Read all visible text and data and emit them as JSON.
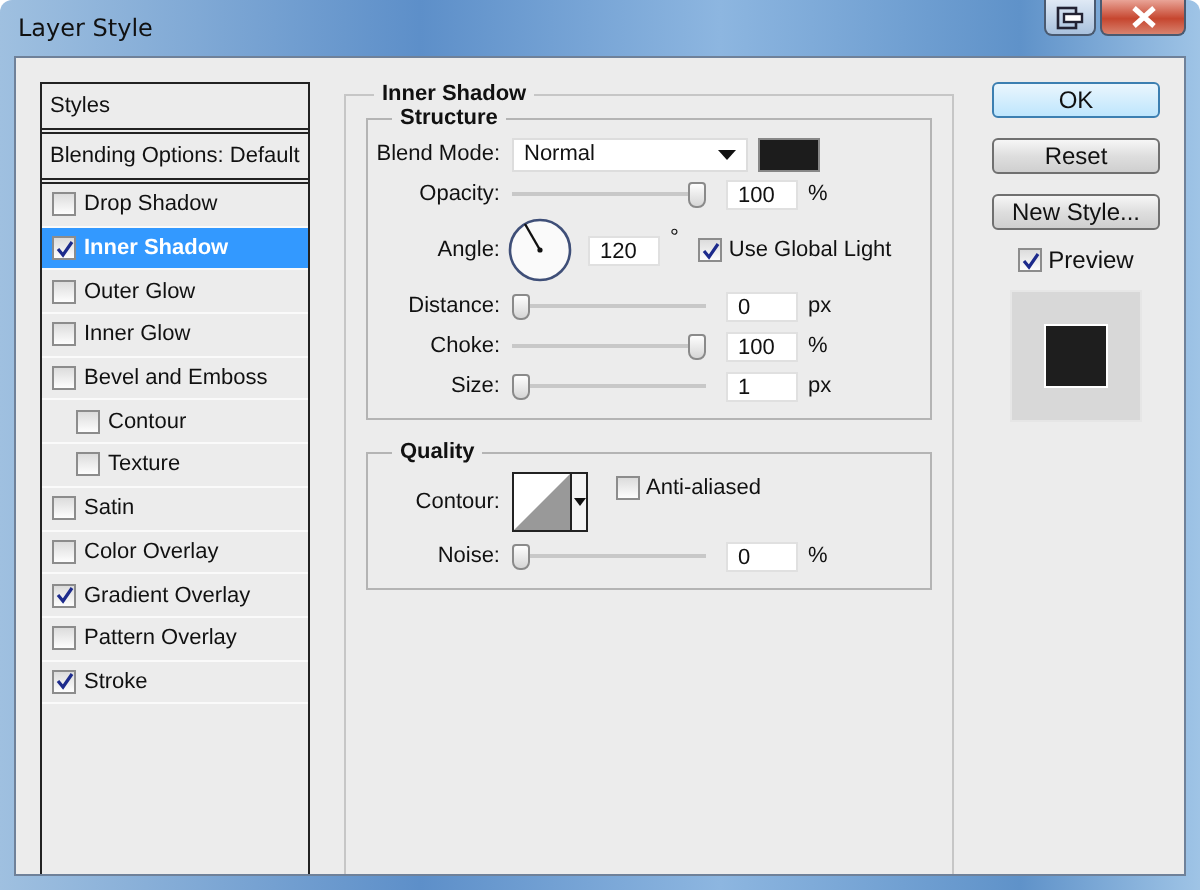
{
  "window": {
    "title": "Layer Style"
  },
  "styles_list": {
    "header": "Styles",
    "items": [
      {
        "kind": "plain",
        "label": "Blending Options: Default",
        "selected": false
      },
      {
        "kind": "check",
        "label": "Drop Shadow",
        "checked": false,
        "selected": false
      },
      {
        "kind": "check",
        "label": "Inner Shadow",
        "checked": true,
        "selected": true
      },
      {
        "kind": "check",
        "label": "Outer Glow",
        "checked": false,
        "selected": false
      },
      {
        "kind": "check",
        "label": "Inner Glow",
        "checked": false,
        "selected": false
      },
      {
        "kind": "check",
        "label": "Bevel and Emboss",
        "checked": false,
        "selected": false,
        "children": [
          {
            "kind": "check",
            "label": "Contour",
            "checked": false,
            "selected": false
          },
          {
            "kind": "check",
            "label": "Texture",
            "checked": false,
            "selected": false
          }
        ]
      },
      {
        "kind": "check",
        "label": "Satin",
        "checked": false,
        "selected": false
      },
      {
        "kind": "check",
        "label": "Color Overlay",
        "checked": false,
        "selected": false
      },
      {
        "kind": "check",
        "label": "Gradient Overlay",
        "checked": true,
        "selected": false
      },
      {
        "kind": "check",
        "label": "Pattern Overlay",
        "checked": false,
        "selected": false
      },
      {
        "kind": "check",
        "label": "Stroke",
        "checked": true,
        "selected": false
      }
    ]
  },
  "panel": {
    "title": "Inner Shadow",
    "structure": {
      "title": "Structure",
      "rows": [
        {
          "kind": "select",
          "label": "Blend Mode:",
          "value": "Normal"
        },
        {
          "kind": "slider",
          "label": "Opacity:",
          "level": 1,
          "value": "100",
          "unit": "%"
        },
        {
          "kind": "angle",
          "label": "Angle:",
          "value": "120",
          "unit": "°",
          "global_light": {
            "label": "Use Global Light",
            "checked": true
          }
        },
        {
          "kind": "slider",
          "label": "Distance:",
          "level": 0,
          "value": "0",
          "unit": "px"
        },
        {
          "kind": "slider",
          "label": "Choke:",
          "level": 1,
          "value": "100",
          "unit": "%"
        },
        {
          "kind": "slider",
          "label": "Size:",
          "level": 0,
          "value": "1",
          "unit": "px"
        }
      ]
    },
    "quality": {
      "title": "Quality",
      "rows": [
        {
          "kind": "contour",
          "label": "Contour:",
          "anti_aliased": {
            "label": "Anti-aliased",
            "checked": false
          }
        },
        {
          "kind": "slider",
          "label": "Noise:",
          "level": 0,
          "value": "0",
          "unit": "%"
        }
      ]
    }
  },
  "buttons": [
    "OK",
    "Reset",
    "New Style..."
  ],
  "preview": {
    "label": "Preview",
    "checked": true
  }
}
